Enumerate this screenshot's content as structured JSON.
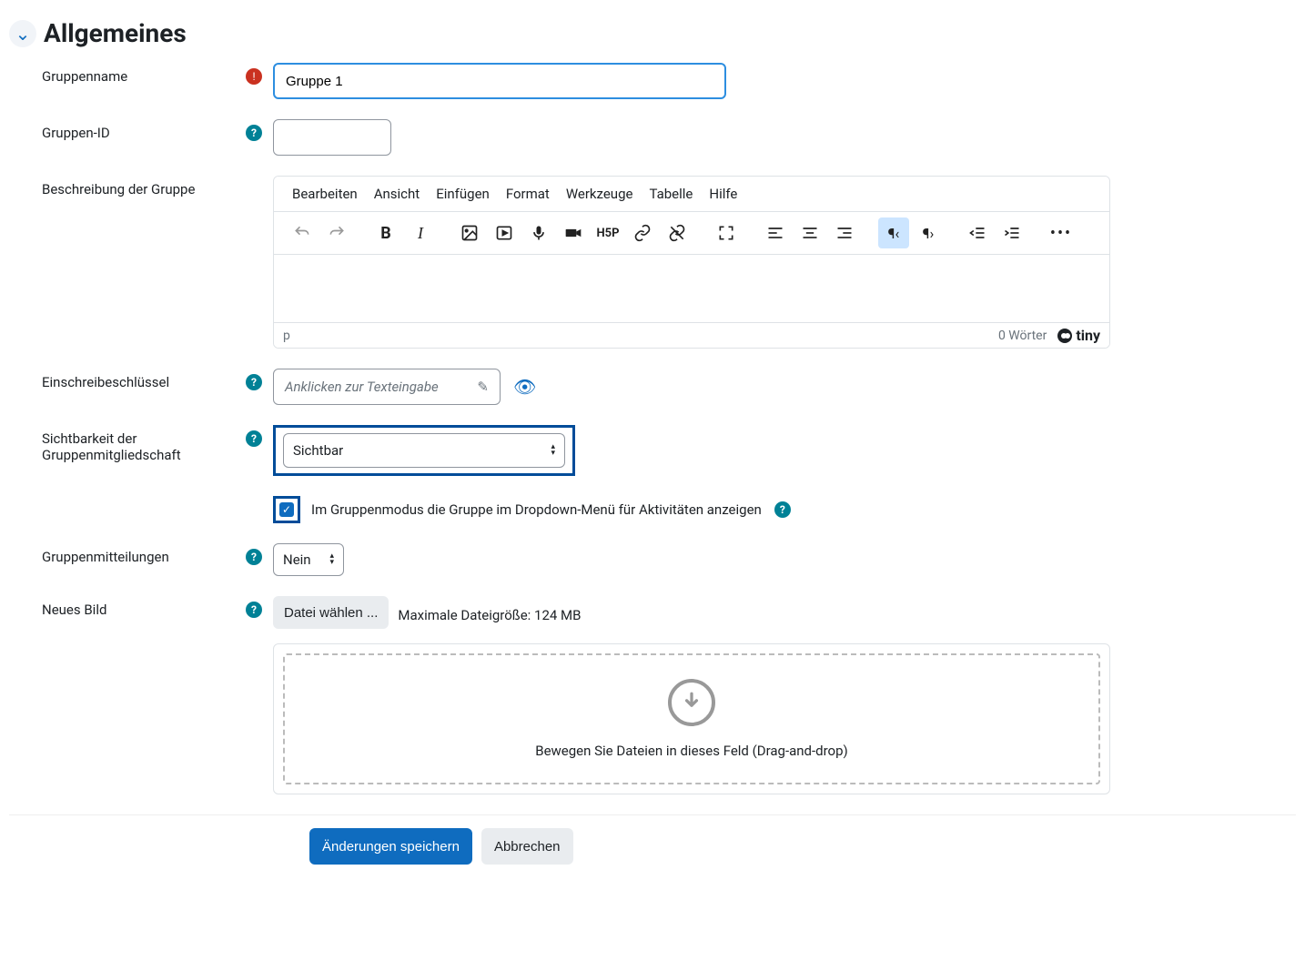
{
  "section": {
    "title": "Allgemeines"
  },
  "fields": {
    "gruppenname": {
      "label": "Gruppenname",
      "value": "Gruppe 1"
    },
    "gruppenid": {
      "label": "Gruppen-ID",
      "value": ""
    },
    "beschreibung": {
      "label": "Beschreibung der Gruppe"
    },
    "einschreib": {
      "label": "Einschreibeschlüssel",
      "placeholder": "Anklicken zur Texteingabe"
    },
    "sichtbarkeit": {
      "label": "Sichtbarkeit der Gruppenmitgliedschaft",
      "value": "Sichtbar"
    },
    "dropdown_checkbox": {
      "label": "Im Gruppenmodus die Gruppe im Dropdown-Menü für Aktivitäten anzeigen"
    },
    "mitteilungen": {
      "label": "Gruppenmitteilungen",
      "value": "Nein"
    },
    "neuesbild": {
      "label": "Neues Bild",
      "button": "Datei wählen ...",
      "info": "Maximale Dateigröße: 124 MB",
      "dropzone": "Bewegen Sie Dateien in dieses Feld (Drag-and-drop)"
    }
  },
  "editor": {
    "menubar": [
      "Bearbeiten",
      "Ansicht",
      "Einfügen",
      "Format",
      "Werkzeuge",
      "Tabelle",
      "Hilfe"
    ],
    "path": "p",
    "wordcount": "0 Wörter",
    "brand": "tiny"
  },
  "buttons": {
    "save": "Änderungen speichern",
    "cancel": "Abbrechen"
  }
}
